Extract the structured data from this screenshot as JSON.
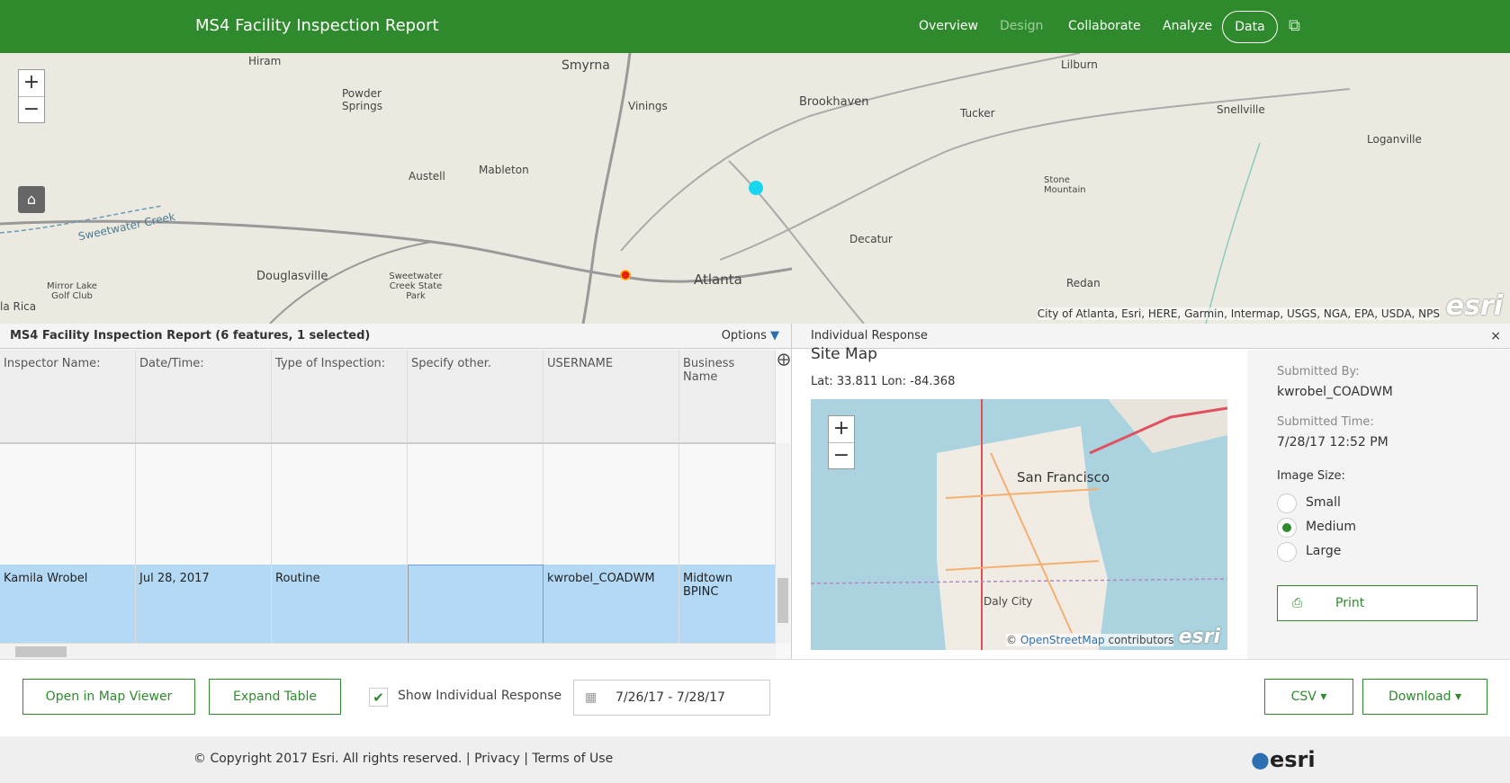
{
  "header": {
    "title": "MS4 Facility Inspection Report",
    "nav": [
      "Overview",
      "Design",
      "Collaborate",
      "Analyze"
    ],
    "data_button": "Data",
    "share_icon": "share-icon",
    "accent": "#2f8a2d"
  },
  "map": {
    "labels": [
      "Hiram",
      "Smyrna",
      "Powder Springs",
      "Vinings",
      "Brookhaven",
      "Lilburn",
      "Tucker",
      "Snellville",
      "Loganville",
      "Austell",
      "Mableton",
      "Stone Mountain",
      "Decatur",
      "Atlanta",
      "Douglasville",
      "Sweetwater Creek State Park",
      "Redan",
      "Mirror Lake Golf Club",
      "la Rica",
      "Sweetwater Creek"
    ],
    "attribution": "City of Atlanta, Esri, HERE, Garmin, Intermap, USGS, NGA, EPA, USDA, NPS",
    "logo": "esri",
    "zoom_in": "+",
    "zoom_out": "−",
    "point_colors": [
      "#19d6f0",
      "#e8200e"
    ]
  },
  "table": {
    "title": "MS4 Facility Inspection Report (6 features, 1 selected)",
    "options": "Options",
    "columns": [
      "Inspector Name:",
      "Date/Time:",
      "Type of Inspection:",
      "Specify other.",
      "USERNAME",
      "Business Name"
    ],
    "selected_row": [
      "Kamila Wrobel",
      "Jul 28, 2017",
      "Routine",
      "",
      "kwrobel_COADWM",
      "Midtown BPINC"
    ],
    "selected_color": "#b4d9f5"
  },
  "response": {
    "title": "Individual Response",
    "close": "×",
    "site_map_title": "Site Map",
    "latlon": "Lat: 33.811 Lon: -84.368",
    "site_map": {
      "city_label": "San Francisco",
      "daly": "Daly City",
      "attribution_prefix": "© ",
      "osm": "OpenStreetMap",
      "attribution_suffix": " contributors",
      "logo": "esri"
    },
    "submitted_by_label": "Submitted By:",
    "submitted_by": "kwrobel_COADWM",
    "submitted_time_label": "Submitted Time:",
    "submitted_time": "7/28/17 12:52 PM",
    "image_size_label": "Image Size:",
    "image_sizes": [
      "Small",
      "Medium",
      "Large"
    ],
    "image_size_selected": "Medium",
    "print": "Print"
  },
  "toolbar": {
    "open_map_viewer": "Open in Map Viewer",
    "expand_table": "Expand Table",
    "show_individual": "Show Individual Response",
    "show_individual_checked": true,
    "date_range": "7/26/17 - 7/28/17",
    "csv": "CSV ▾",
    "download": "Download ▾"
  },
  "footer": {
    "copyright": "© Copyright 2017 Esri.  All rights reserved.  |  Privacy  |  Terms of Use",
    "logo": "esri"
  }
}
